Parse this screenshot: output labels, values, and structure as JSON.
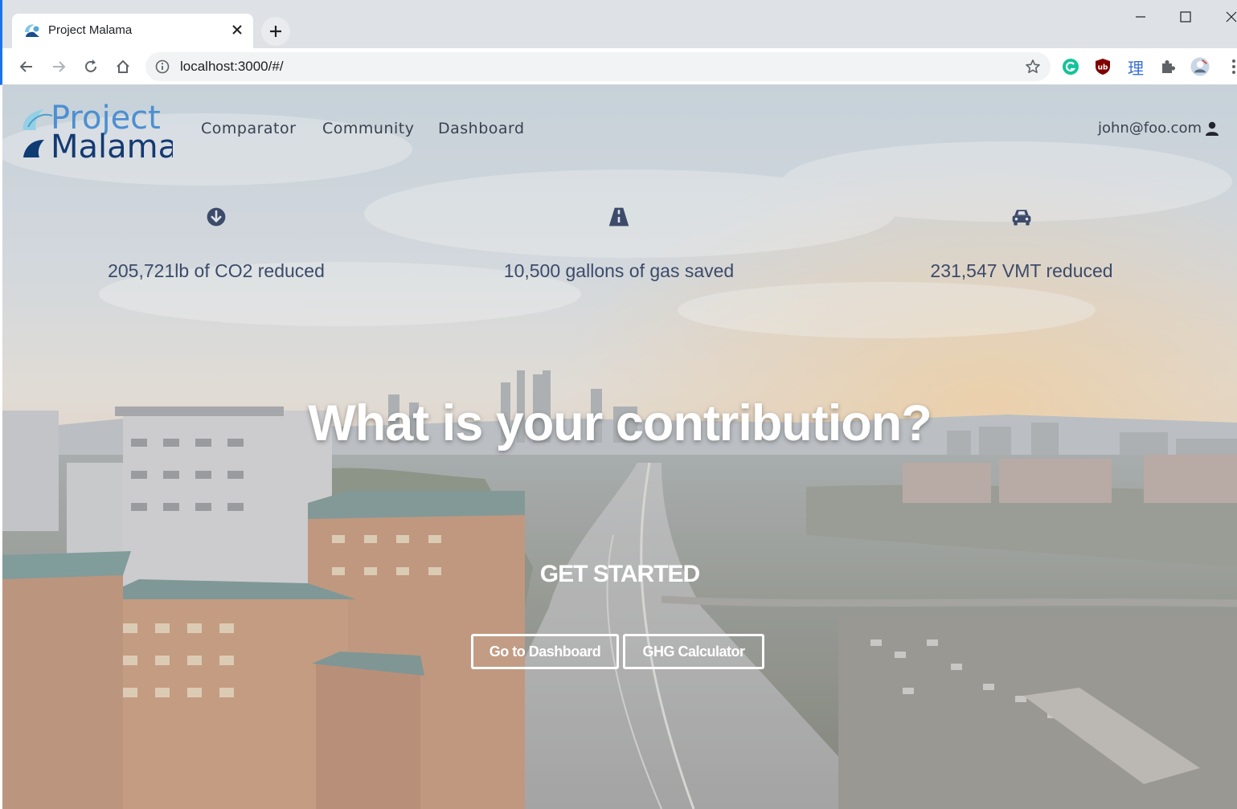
{
  "browser": {
    "tab_title": "Project Malama",
    "url": "localhost:3000/#/",
    "extension_ideogram": "理"
  },
  "site": {
    "logo_line1": "Project",
    "logo_line2": "Malama",
    "nav": [
      "Comparator",
      "Community",
      "Dashboard"
    ],
    "user_email": "john@foo.com"
  },
  "stats": [
    {
      "icon": "arrow-down-circle-icon",
      "text": "205,721lb of CO2 reduced"
    },
    {
      "icon": "road-icon",
      "text": "10,500 gallons of gas saved"
    },
    {
      "icon": "car-icon",
      "text": "231,547 VMT reduced"
    }
  ],
  "hero": {
    "headline": "What is your contribution?",
    "get_started": "GET STARTED",
    "dashboard_button": "Go to Dashboard",
    "calculator_button": "GHG Calculator"
  },
  "colors": {
    "accent": "#1a73e8",
    "nav_text": "#3a4150",
    "stat_text": "#3c4b6a",
    "grammarly": "#15c39a",
    "ublock": "#800000"
  }
}
